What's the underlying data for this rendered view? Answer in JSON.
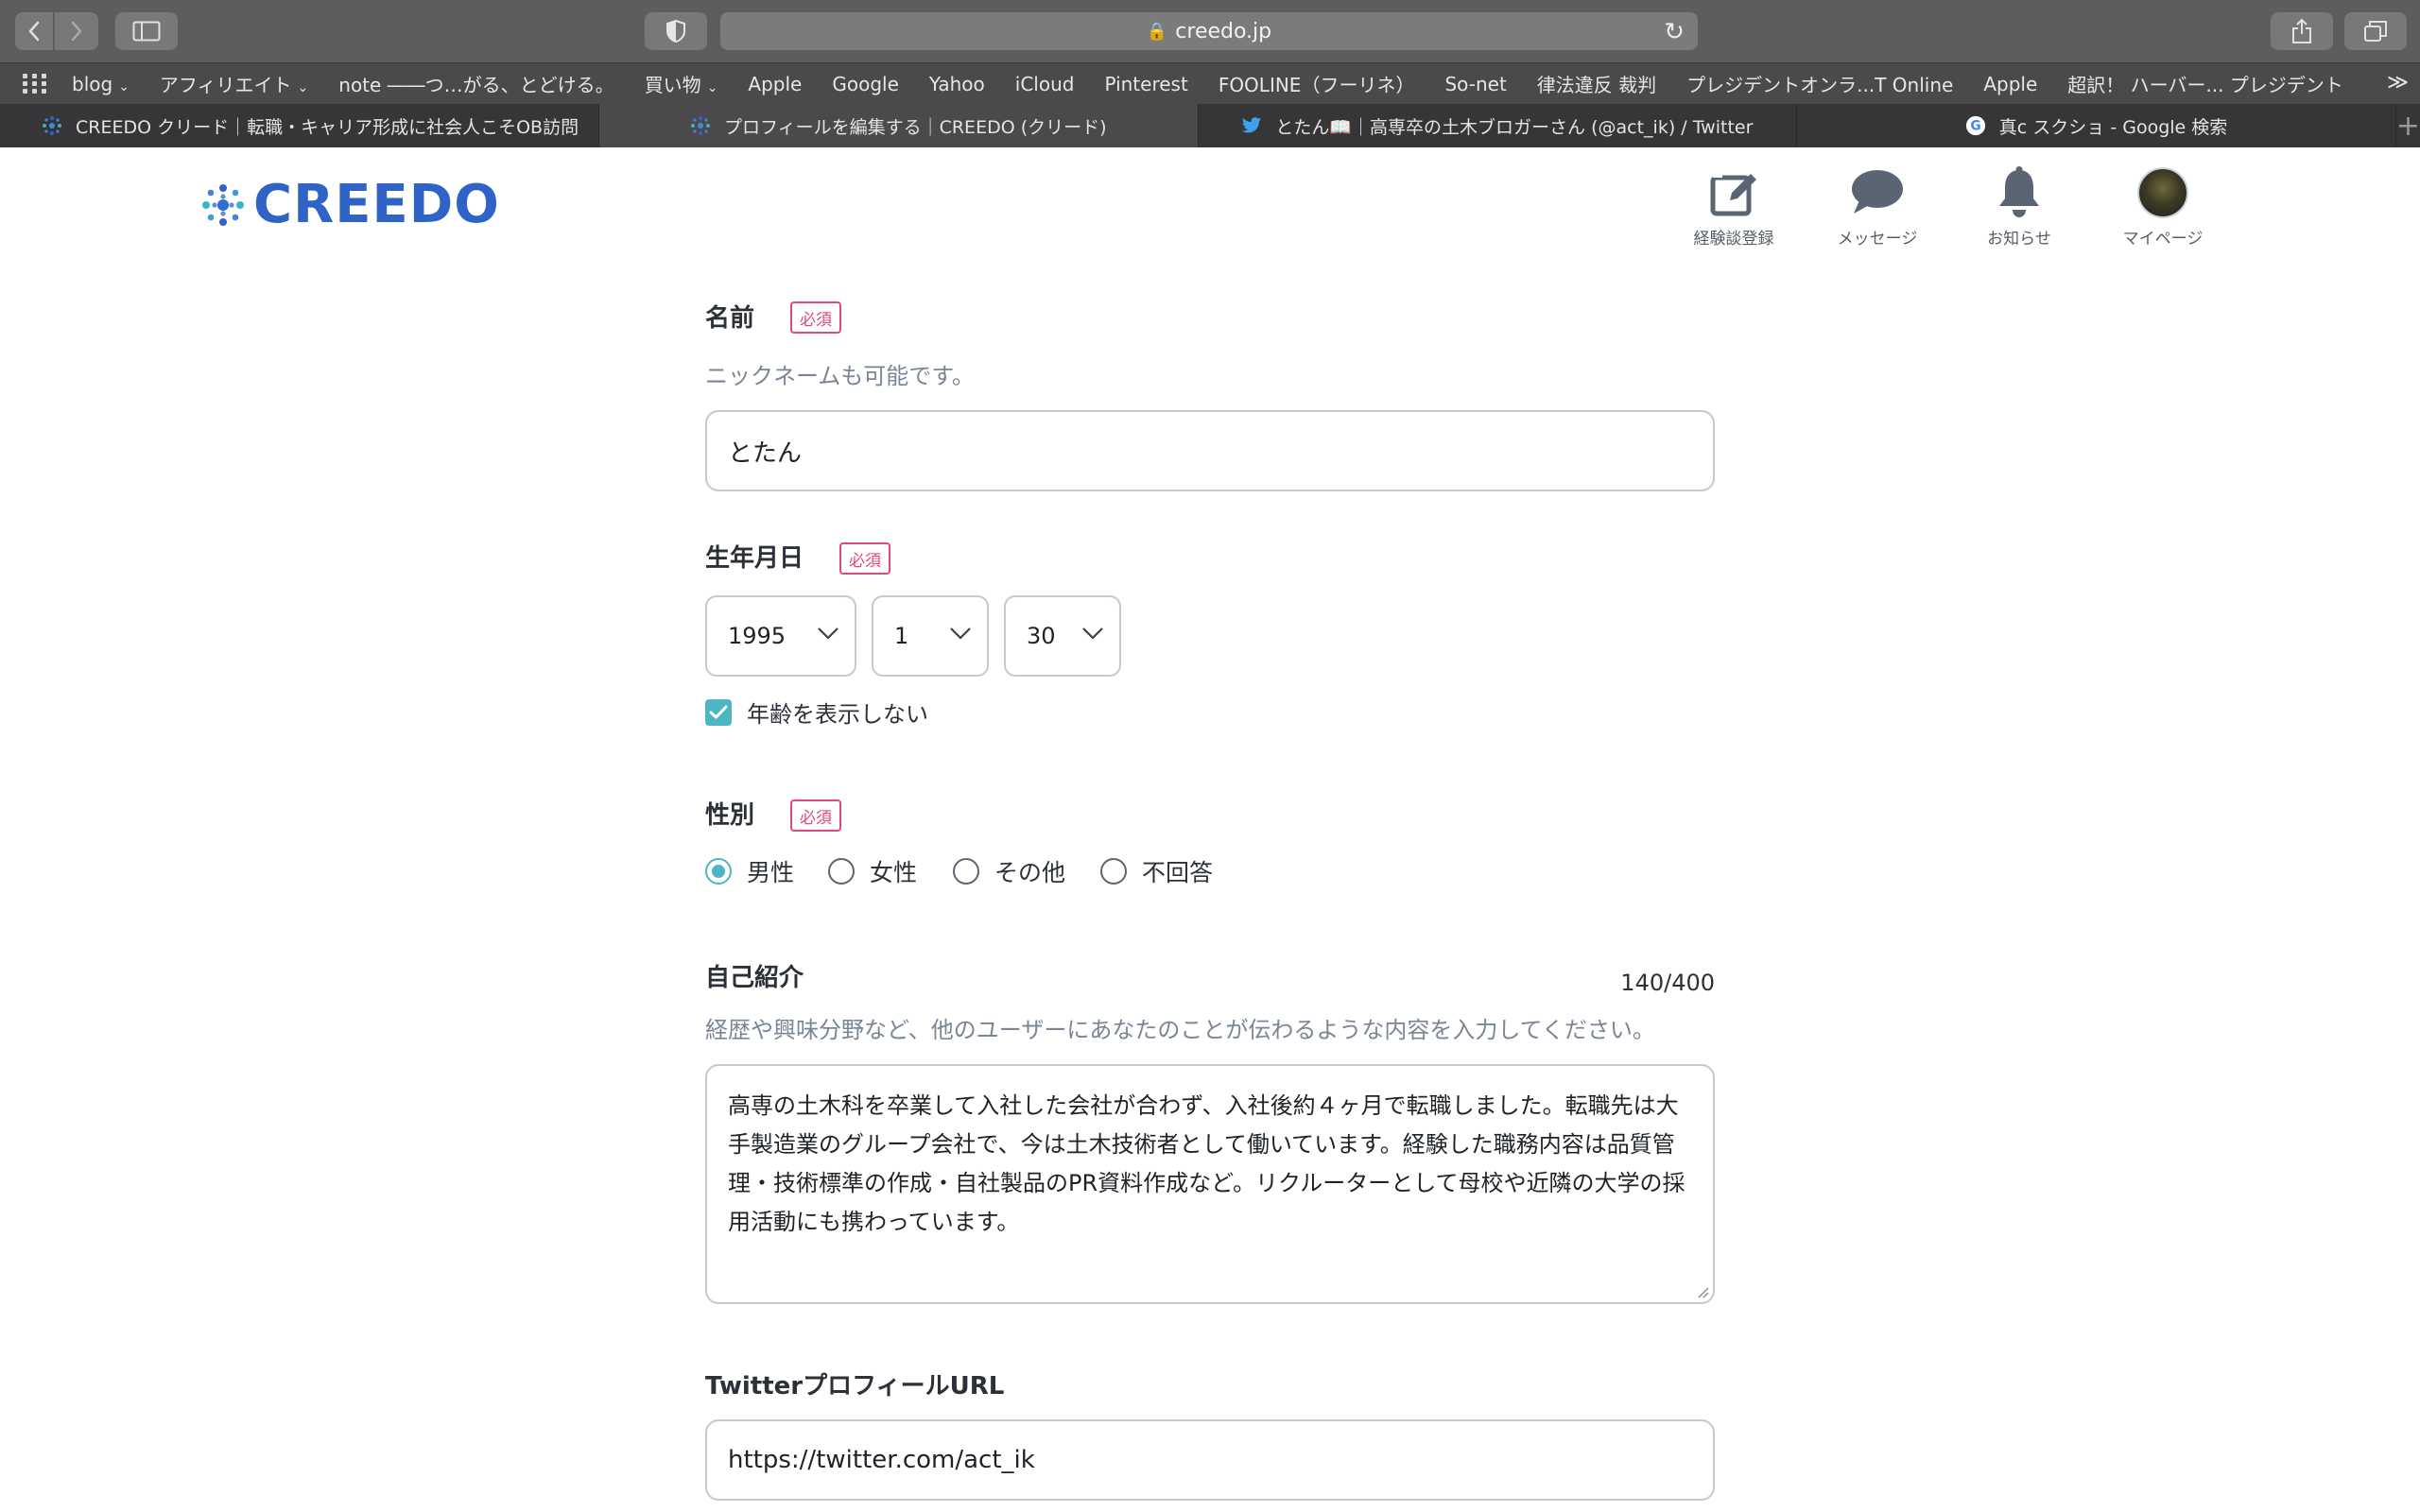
{
  "browser": {
    "url": "creedo.jp",
    "bookmarks": [
      {
        "label": "blog",
        "has_menu": true
      },
      {
        "label": "アフィリエイト",
        "has_menu": true
      },
      {
        "label": "note ――つ…がる、とどける。",
        "has_menu": false
      },
      {
        "label": "買い物",
        "has_menu": true
      },
      {
        "label": "Apple",
        "has_menu": false
      },
      {
        "label": "Google",
        "has_menu": false
      },
      {
        "label": "Yahoo",
        "has_menu": false
      },
      {
        "label": "iCloud",
        "has_menu": false
      },
      {
        "label": "Pinterest",
        "has_menu": false
      },
      {
        "label": "FOOLINE（フーリネ）",
        "has_menu": false
      },
      {
        "label": "So-net",
        "has_menu": false
      },
      {
        "label": "律法違反 裁判",
        "has_menu": false
      },
      {
        "label": "プレジデントオンラ...T Online",
        "has_menu": false
      },
      {
        "label": "Apple",
        "has_menu": false
      },
      {
        "label": "超訳！ ハーバー... プレジデント",
        "has_menu": false
      }
    ],
    "tabs": [
      {
        "title": "CREEDO クリード｜転職・キャリア形成に社会人こそOB訪問",
        "favicon": "creedo-icon"
      },
      {
        "title": "プロフィールを編集する｜CREEDO (クリード)",
        "favicon": "creedo-icon"
      },
      {
        "title": "とたん📖｜高専卒の土木ブロガーさん (@act_ik) / Twitter",
        "favicon": "twitter-bird-icon"
      },
      {
        "title": "真c スクショ - Google 検索",
        "favicon": "google-g-icon"
      }
    ]
  },
  "header": {
    "logo_text": "CREEDO",
    "nav": [
      {
        "label": "経験談登録",
        "icon": "edit-icon"
      },
      {
        "label": "メッセージ",
        "icon": "chat-bubble-icon"
      },
      {
        "label": "お知らせ",
        "icon": "bell-icon"
      },
      {
        "label": "マイページ",
        "icon": "avatar"
      }
    ]
  },
  "form": {
    "required_badge": "必須",
    "name": {
      "label": "名前",
      "hint": "ニックネームも可能です。",
      "value": "とたん"
    },
    "birthday": {
      "label": "生年月日",
      "year": "1995",
      "month": "1",
      "day": "30",
      "hide_age_label": "年齢を表示しない",
      "hide_age_checked": true
    },
    "gender": {
      "label": "性別",
      "options": [
        "男性",
        "女性",
        "その他",
        "不回答"
      ],
      "selected": "男性"
    },
    "bio": {
      "label": "自己紹介",
      "counter": "140/400",
      "hint": "経歴や興味分野など、他のユーザーにあなたのことが伝わるような内容を入力してください。",
      "value": "高専の土木科を卒業して入社した会社が合わず、入社後約４ヶ月で転職しました。転職先は大手製造業のグループ会社で、今は土木技術者として働いています。経験した職務内容は品質管理・技術標準の作成・自社製品のPR資料作成など。リクルーターとして母校や近隣の大学の採用活動にも携わっています。"
    },
    "twitter": {
      "label": "TwitterプロフィールURL",
      "value": "https://twitter.com/act_ik"
    }
  },
  "colors": {
    "brand": "#2f64c6",
    "required": "#e0497b",
    "accent_teal": "#4cb7c3",
    "hint": "#7a8595"
  }
}
